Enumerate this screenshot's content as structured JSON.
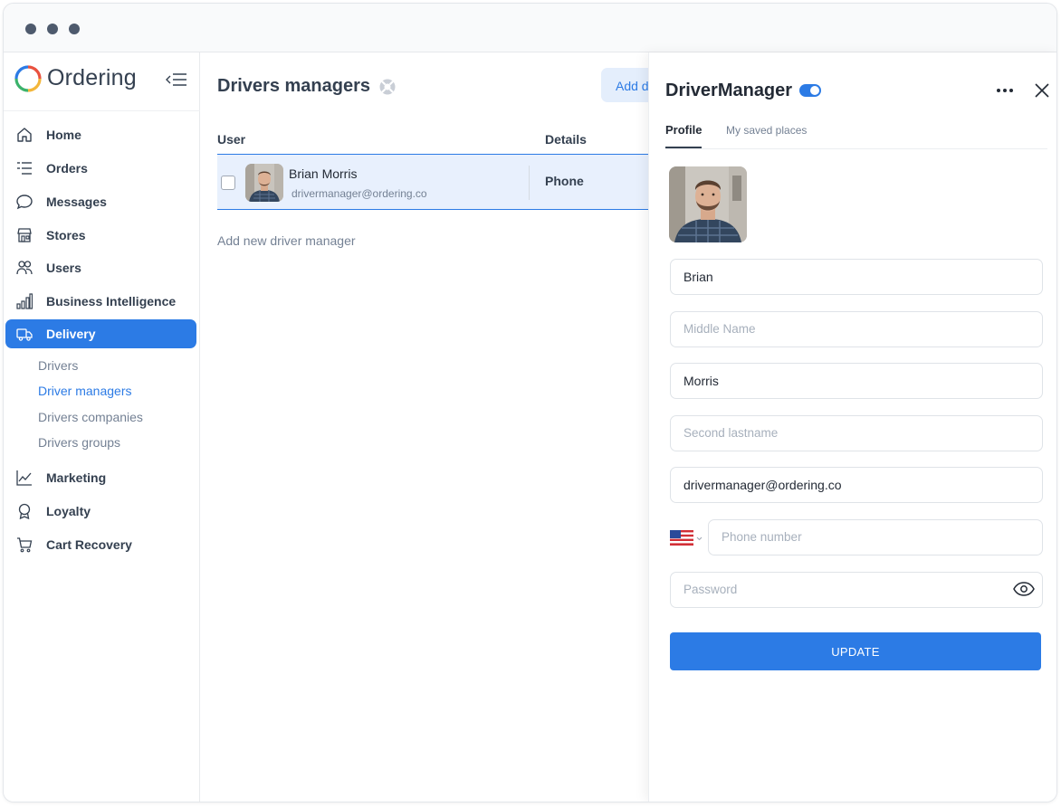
{
  "app": {
    "name": "Ordering"
  },
  "sidebar": {
    "items": [
      {
        "label": "Home",
        "icon": "home-icon"
      },
      {
        "label": "Orders",
        "icon": "orders-list-icon"
      },
      {
        "label": "Messages",
        "icon": "chat-bubble-icon"
      },
      {
        "label": "Stores",
        "icon": "store-icon"
      },
      {
        "label": "Users",
        "icon": "users-icon"
      },
      {
        "label": "Business Intelligence",
        "icon": "bar-chart-icon"
      },
      {
        "label": "Delivery",
        "icon": "truck-icon",
        "active": true
      },
      {
        "label": "Marketing",
        "icon": "line-chart-icon"
      },
      {
        "label": "Loyalty",
        "icon": "award-icon"
      },
      {
        "label": "Cart Recovery",
        "icon": "cart-icon"
      }
    ],
    "delivery_sub": [
      {
        "label": "Drivers"
      },
      {
        "label": "Driver managers",
        "active": true
      },
      {
        "label": "Drivers companies"
      },
      {
        "label": "Drivers groups"
      }
    ]
  },
  "main": {
    "title": "Drivers managers",
    "add_button": "Add driver manager",
    "table": {
      "headers": [
        "User",
        "Details"
      ],
      "rows": [
        {
          "name": "Brian Morris",
          "email": "drivermanager@ordering.co",
          "detail": "Phone"
        }
      ]
    },
    "add_link": "Add new driver manager"
  },
  "panel": {
    "title": "DriverManager",
    "tabs": [
      "Profile",
      "My saved places"
    ],
    "fields": {
      "first_name": "Brian",
      "middle_name_placeholder": "Middle Name",
      "last_name": "Morris",
      "second_lastname_placeholder": "Second lastname",
      "email": "drivermanager@ordering.co",
      "phone_placeholder": "Phone number",
      "password_placeholder": "Password"
    },
    "update_button": "UPDATE"
  },
  "colors": {
    "accent": "#2c7be5",
    "text": "#344050",
    "muted": "#748194"
  }
}
